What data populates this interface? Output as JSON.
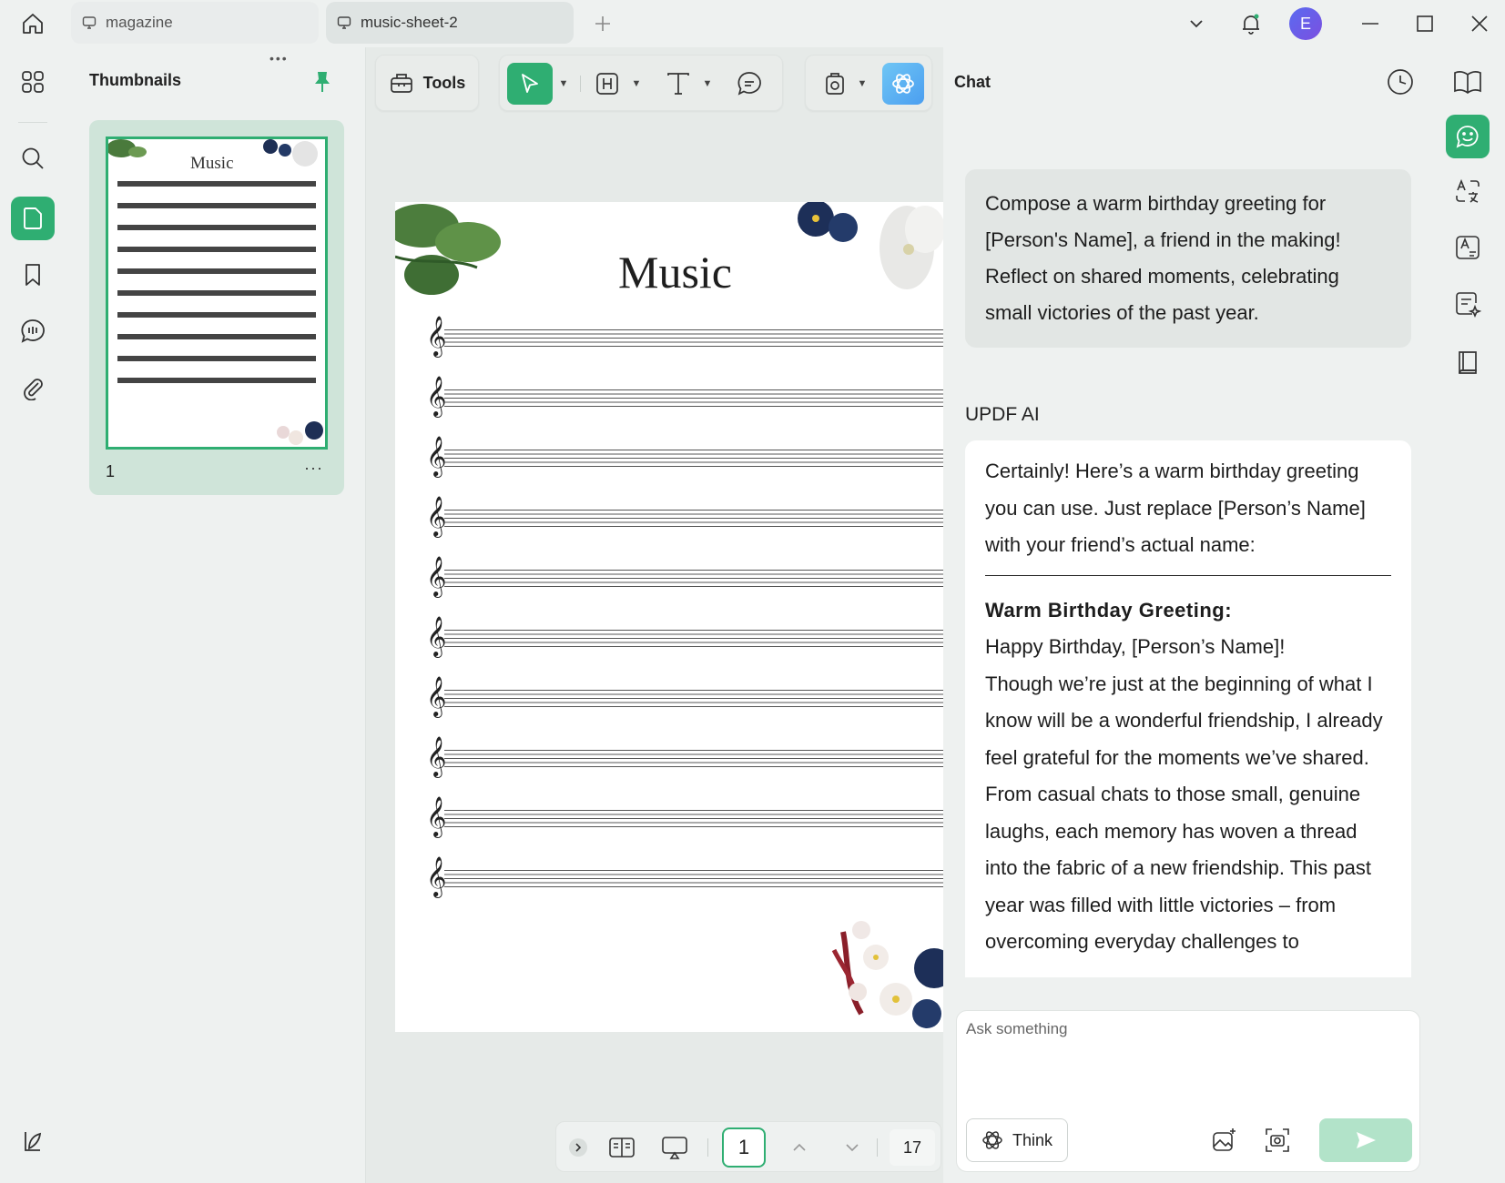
{
  "tabs": [
    {
      "label": "magazine"
    },
    {
      "label": "music-sheet-2"
    }
  ],
  "user": {
    "avatar_initial": "E"
  },
  "colors": {
    "accent": "#2fae72",
    "accent_light": "#b2e3c9",
    "selected_bg": "#cfe4d9"
  },
  "thumbnails": {
    "title": "Thumbnails",
    "page_label": "1",
    "more": "···",
    "page_title": "Music"
  },
  "toolbar": {
    "tools_label": "Tools"
  },
  "document": {
    "title": "Music",
    "clef": "𝄞"
  },
  "page_nav": {
    "current": "1",
    "total": "17"
  },
  "chat": {
    "title": "Chat",
    "user_message": "Compose a warm birthday greeting for [Person's Name], a friend in the making! Reflect on shared moments, celebrating small victories of the past year.",
    "ai_label": "UPDF AI",
    "ai_intro": "Certainly! Here’s a warm birthday greeting you can use. Just replace [Person’s Name] with your friend’s actual name:",
    "ai_heading": "Warm Birthday Greeting:",
    "ai_greeting": "Happy Birthday, [Person’s Name]!",
    "ai_body": "Though we’re just at the beginning of what I know will be a wonderful friendship, I already feel grateful for the moments we’ve shared. From casual chats to those small, genuine laughs, each memory has woven a thread into the fabric of a new friendship. This past year was filled with little victories – from overcoming everyday challenges to",
    "input_placeholder": "Ask something",
    "think_label": "Think"
  },
  "icons": {
    "home": "home-icon",
    "monitor": "monitor-icon",
    "plus": "plus-icon",
    "chevron": "chevron-down-icon",
    "bell": "bell-icon",
    "minimize": "minimize-icon",
    "maximize": "maximize-icon",
    "close": "close-icon"
  }
}
